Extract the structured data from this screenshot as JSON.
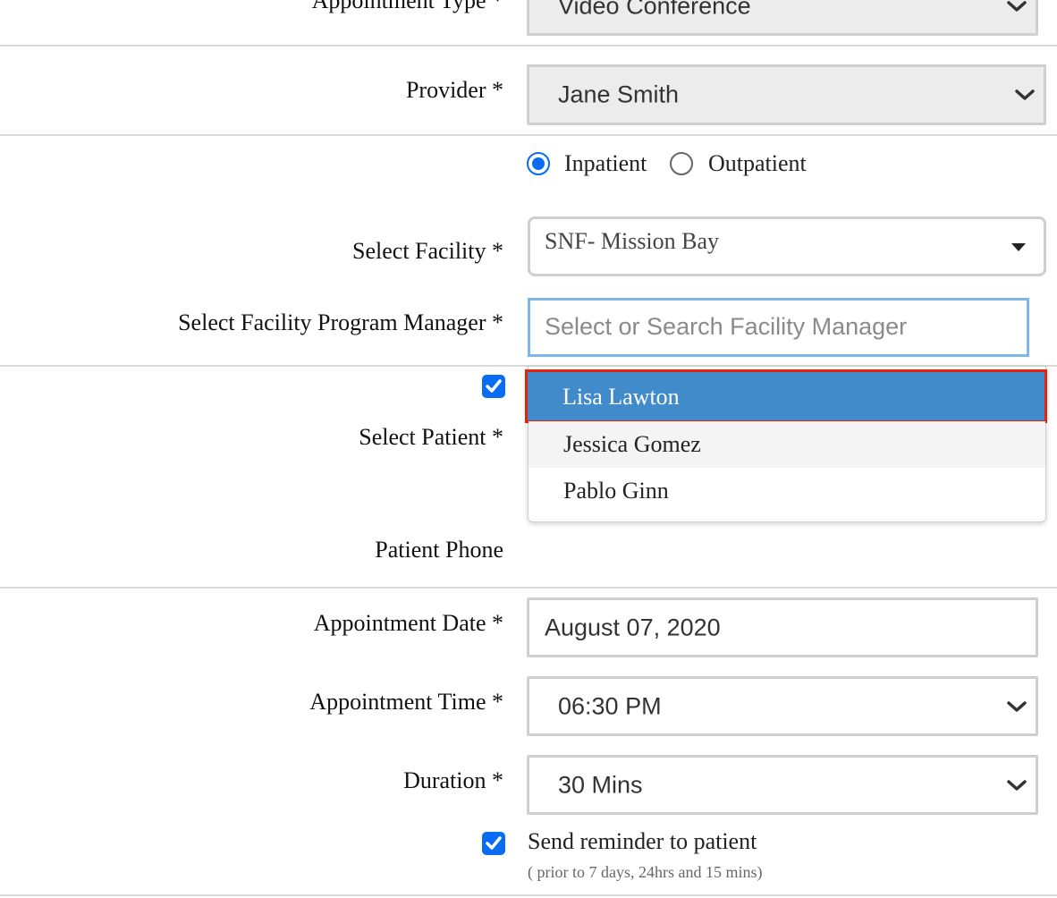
{
  "form": {
    "appointment_type": {
      "label": "Appointment Type *",
      "value": "Video Conference"
    },
    "provider": {
      "label": "Provider *",
      "value": "Jane Smith"
    },
    "patient_type": {
      "inpatient_label": "Inpatient",
      "outpatient_label": "Outpatient",
      "selected": "Inpatient"
    },
    "facility": {
      "label": "Select Facility *",
      "value": "SNF- Mission Bay"
    },
    "facility_manager": {
      "label": "Select Facility Program Manager *",
      "placeholder": "Select or Search Facility Manager",
      "options": [
        "Lisa Lawton",
        "Jessica Gomez",
        "Pablo Ginn"
      ],
      "highlighted": "Lisa Lawton"
    },
    "patient": {
      "label": "Select Patient *",
      "checkbox_checked": true
    },
    "patient_phone": {
      "label": "Patient Phone"
    },
    "appointment_date": {
      "label": "Appointment Date *",
      "value": "August 07, 2020"
    },
    "appointment_time": {
      "label": "Appointment Time *",
      "value": "06:30 PM"
    },
    "duration": {
      "label": "Duration *",
      "value": "30 Mins"
    },
    "reminder": {
      "label": "Send reminder to patient",
      "note": "( prior to 7 days, 24hrs and 15 mins)",
      "checked": true
    }
  },
  "colors": {
    "accent": "#0a6cf2",
    "highlight_bg": "#428bca",
    "highlight_border": "#e8210c",
    "field_bg": "#ececec"
  }
}
